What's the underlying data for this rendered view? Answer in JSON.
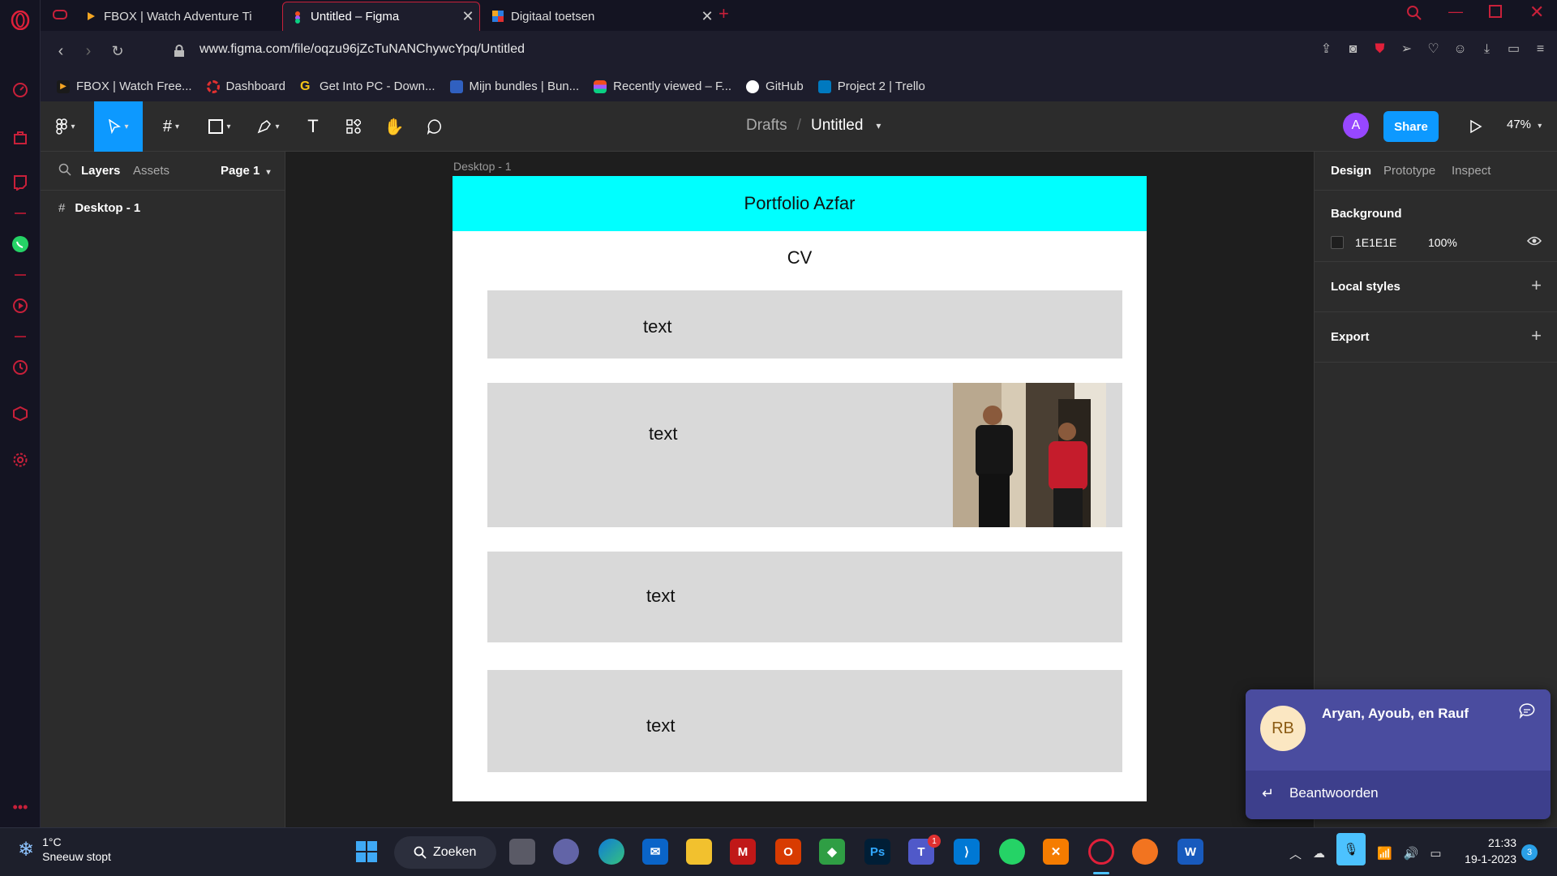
{
  "browser": {
    "tabs": [
      {
        "label": "FBOX | Watch Adventure Ti",
        "active": false
      },
      {
        "label": "Untitled – Figma",
        "active": true
      },
      {
        "label": "Digitaal toetsen",
        "active": false
      }
    ],
    "url": "www.figma.com/file/oqzu96jZcTuNANChywcYpq/Untitled",
    "bookmarks": [
      {
        "label": "FBOX | Watch Free...",
        "color": "#1a1a1a"
      },
      {
        "label": "Dashboard",
        "color": "#e03030"
      },
      {
        "label": "Get Into PC - Down...",
        "color": "#1a1a1a"
      },
      {
        "label": "Mijn bundles | Bun...",
        "color": "#3060c0"
      },
      {
        "label": "Recently viewed – F...",
        "color": "#f24e1e"
      },
      {
        "label": "GitHub",
        "color": "#ffffff"
      },
      {
        "label": "Project 2 | Trello",
        "color": "#0079bf"
      }
    ]
  },
  "figma": {
    "breadcrumb": {
      "drafts": "Drafts",
      "file": "Untitled"
    },
    "avatar": "A",
    "share_label": "Share",
    "zoom": "47%",
    "left_panel": {
      "tabs": {
        "layers": "Layers",
        "assets": "Assets"
      },
      "page": "Page 1",
      "layers": [
        {
          "name": "Desktop - 1"
        }
      ]
    },
    "canvas": {
      "frame_label": "Desktop - 1",
      "header_title": "Portfolio Azfar",
      "subtitle": "CV",
      "boxes": [
        "text",
        "text",
        "text",
        "text"
      ]
    },
    "right_panel": {
      "tabs": [
        "Design",
        "Prototype",
        "Inspect"
      ],
      "background_title": "Background",
      "background_hex": "1E1E1E",
      "background_opacity": "100%",
      "local_styles": "Local styles",
      "export": "Export"
    }
  },
  "toast": {
    "initials": "RB",
    "name": "Aryan, Ayoub, en Rauf",
    "reply": "Beantwoorden"
  },
  "taskbar": {
    "temperature": "1°C",
    "weather": "Sneeuw stopt",
    "search": "Zoeken",
    "time": "21:33",
    "date": "19-1-2023",
    "notifications": "3",
    "teams_badge": "1"
  },
  "colors": {
    "accent": "#0d99ff",
    "frame_header": "#00ffff",
    "box": "#d9d9d9",
    "opera_red": "#c8203a"
  }
}
